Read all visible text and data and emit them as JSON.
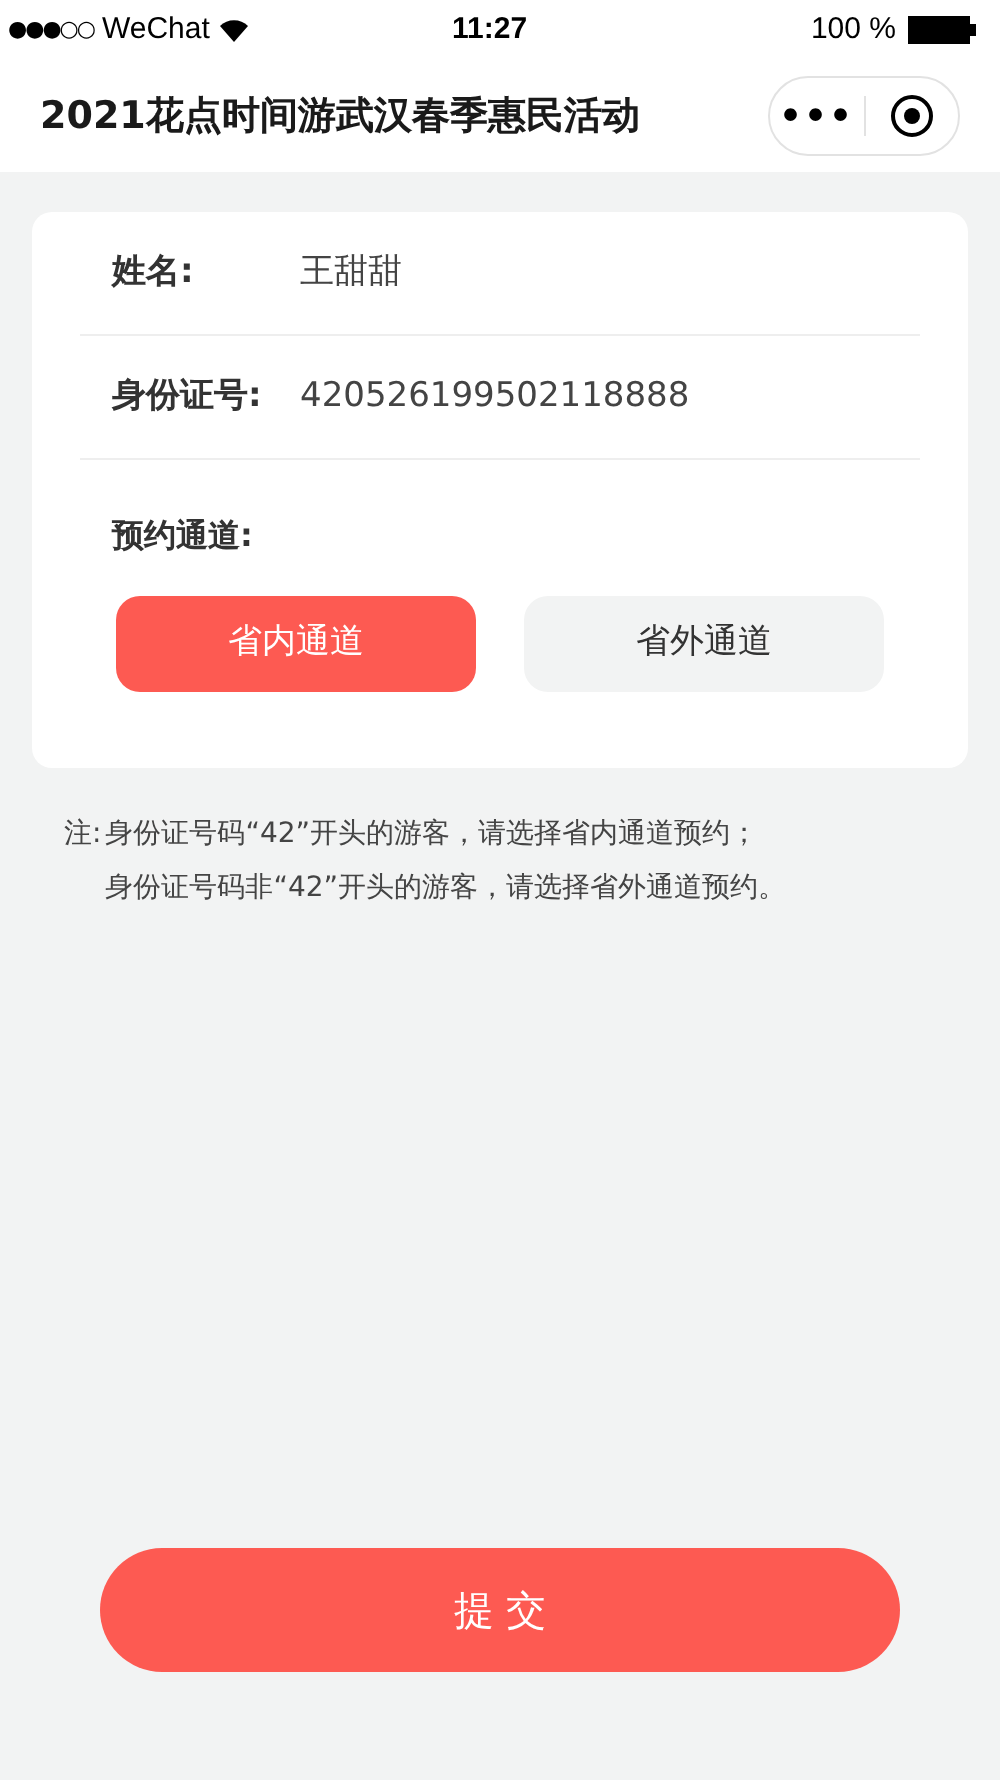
{
  "status_bar": {
    "signal": "●●●○○",
    "carrier": "WeChat",
    "time": "11:27",
    "battery": "100 %"
  },
  "nav": {
    "title": "2021花点时间游武汉春季惠民活动",
    "menu": "•••"
  },
  "form": {
    "fields": [
      {
        "label": "姓名:",
        "value": "王甜甜"
      },
      {
        "label": "身份证号:",
        "value": "420526199502118888"
      }
    ],
    "channel_label": "预约通道:",
    "channels": [
      {
        "label": "省内通道",
        "selected": true
      },
      {
        "label": "省外通道",
        "selected": false
      }
    ]
  },
  "note": {
    "prefix": "注:",
    "lines": [
      "身份证号码“42”开头的游客，请选择省内通道预约；",
      "身份证号码非“42”开头的游客，请选择省外通道预约。"
    ]
  },
  "submit": "提 交"
}
